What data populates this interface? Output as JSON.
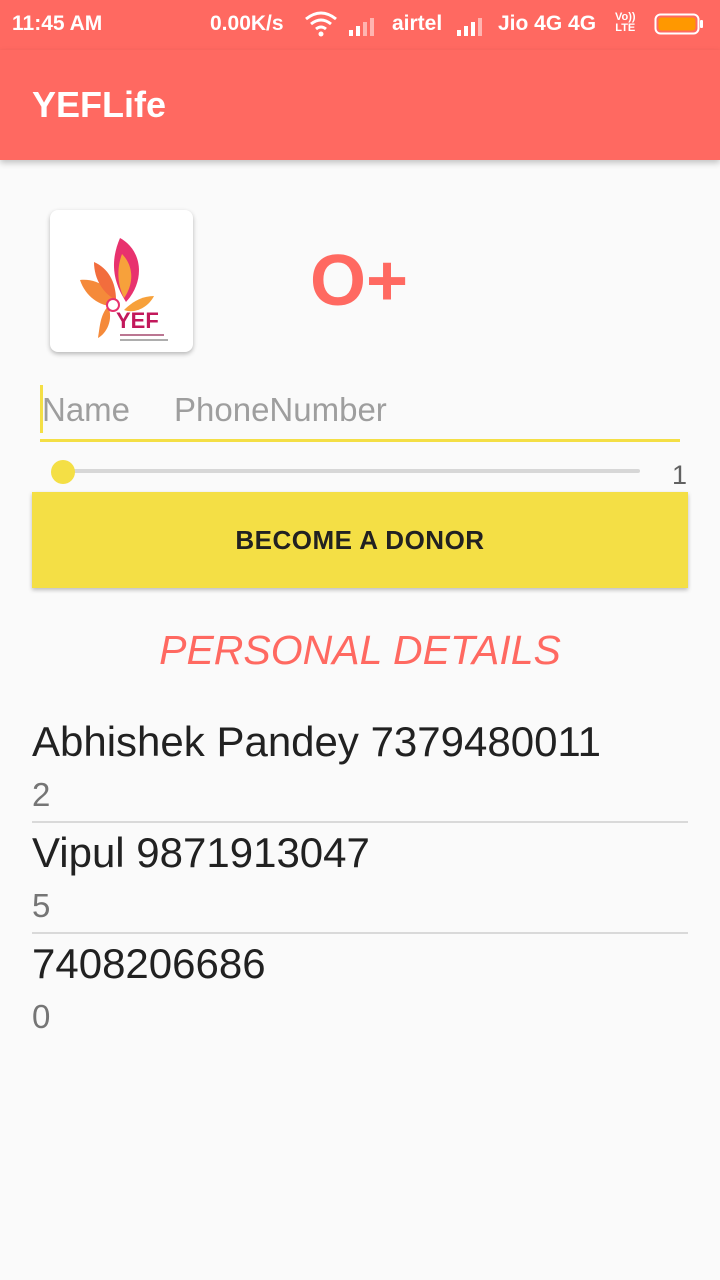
{
  "status_bar": {
    "time": "11:45 AM",
    "network_speed": "0.00K/s",
    "carrier_1": "airtel",
    "carrier_2": "Jio 4G 4G",
    "volte_top": "Vo))",
    "volte_bottom": "LTE"
  },
  "app_bar": {
    "title": "YEFLife"
  },
  "logo": {
    "text": "YEF"
  },
  "blood_group": "O+",
  "form": {
    "name_placeholder": "Name",
    "phone_placeholder": "PhoneNumber",
    "slider_value": "1",
    "donor_button": "BECOME A DONOR"
  },
  "section_title": "PERSONAL DETAILS",
  "donors": [
    {
      "primary": "Abhishek Pandey 7379480011",
      "secondary": "2"
    },
    {
      "primary": "Vipul 9871913047",
      "secondary": "5"
    },
    {
      "primary": "7408206686",
      "secondary": "0"
    }
  ],
  "colors": {
    "primary": "#ff6961",
    "accent": "#f4df45",
    "background": "#fafafa"
  },
  "icons": [
    "wifi-icon",
    "signal-icon",
    "volte-icon",
    "battery-icon"
  ]
}
